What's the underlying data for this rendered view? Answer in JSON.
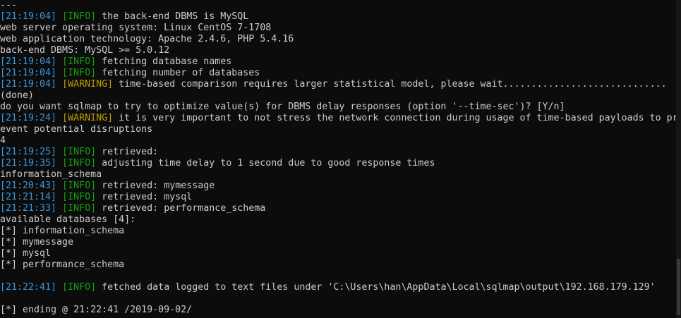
{
  "colors": {
    "background": "#0c0c0c",
    "text": "#cccccc",
    "timestamp": "#3a96dd",
    "info": "#13a10e",
    "warning": "#c19c00"
  },
  "lines": [
    [
      {
        "t": "plain",
        "v": "---"
      }
    ],
    [
      {
        "t": "time",
        "v": "[21:19:04]"
      },
      {
        "t": "plain",
        "v": " "
      },
      {
        "t": "info",
        "v": "[INFO]"
      },
      {
        "t": "plain",
        "v": " the back-end DBMS is MySQL"
      }
    ],
    [
      {
        "t": "plain",
        "v": "web server operating system: Linux CentOS 7-1708"
      }
    ],
    [
      {
        "t": "plain",
        "v": "web application technology: Apache 2.4.6, PHP 5.4.16"
      }
    ],
    [
      {
        "t": "plain",
        "v": "back-end DBMS: MySQL >= 5.0.12"
      }
    ],
    [
      {
        "t": "time",
        "v": "[21:19:04]"
      },
      {
        "t": "plain",
        "v": " "
      },
      {
        "t": "info",
        "v": "[INFO]"
      },
      {
        "t": "plain",
        "v": " fetching database names"
      }
    ],
    [
      {
        "t": "time",
        "v": "[21:19:04]"
      },
      {
        "t": "plain",
        "v": " "
      },
      {
        "t": "info",
        "v": "[INFO]"
      },
      {
        "t": "plain",
        "v": " fetching number of databases"
      }
    ],
    [
      {
        "t": "time",
        "v": "[21:19:04]"
      },
      {
        "t": "plain",
        "v": " "
      },
      {
        "t": "warn",
        "v": "[WARNING]"
      },
      {
        "t": "plain",
        "v": " time-based comparison requires larger statistical model, please wait............................."
      }
    ],
    [
      {
        "t": "plain",
        "v": "(done)"
      }
    ],
    [
      {
        "t": "plain",
        "v": "do you want sqlmap to try to optimize value(s) for DBMS delay responses (option '--time-sec')? [Y/n]"
      }
    ],
    [
      {
        "t": "time",
        "v": "[21:19:24]"
      },
      {
        "t": "plain",
        "v": " "
      },
      {
        "t": "warn",
        "v": "[WARNING]"
      },
      {
        "t": "plain",
        "v": " it is very important to not stress the network connection during usage of time-based payloads to pr"
      }
    ],
    [
      {
        "t": "plain",
        "v": "event potential disruptions"
      }
    ],
    [
      {
        "t": "plain",
        "v": "4"
      }
    ],
    [
      {
        "t": "time",
        "v": "[21:19:25]"
      },
      {
        "t": "plain",
        "v": " "
      },
      {
        "t": "info",
        "v": "[INFO]"
      },
      {
        "t": "plain",
        "v": " retrieved:"
      }
    ],
    [
      {
        "t": "time",
        "v": "[21:19:35]"
      },
      {
        "t": "plain",
        "v": " "
      },
      {
        "t": "info",
        "v": "[INFO]"
      },
      {
        "t": "plain",
        "v": " adjusting time delay to 1 second due to good response times"
      }
    ],
    [
      {
        "t": "plain",
        "v": "information_schema"
      }
    ],
    [
      {
        "t": "time",
        "v": "[21:20:43]"
      },
      {
        "t": "plain",
        "v": " "
      },
      {
        "t": "info",
        "v": "[INFO]"
      },
      {
        "t": "plain",
        "v": " retrieved: mymessage"
      }
    ],
    [
      {
        "t": "time",
        "v": "[21:21:14]"
      },
      {
        "t": "plain",
        "v": " "
      },
      {
        "t": "info",
        "v": "[INFO]"
      },
      {
        "t": "plain",
        "v": " retrieved: mysql"
      }
    ],
    [
      {
        "t": "time",
        "v": "[21:21:33]"
      },
      {
        "t": "plain",
        "v": " "
      },
      {
        "t": "info",
        "v": "[INFO]"
      },
      {
        "t": "plain",
        "v": " retrieved: performance_schema"
      }
    ],
    [
      {
        "t": "plain",
        "v": "available databases [4]:"
      }
    ],
    [
      {
        "t": "plain",
        "v": "[*] information_schema"
      }
    ],
    [
      {
        "t": "plain",
        "v": "[*] mymessage"
      }
    ],
    [
      {
        "t": "plain",
        "v": "[*] mysql"
      }
    ],
    [
      {
        "t": "plain",
        "v": "[*] performance_schema"
      }
    ],
    [
      {
        "t": "plain",
        "v": ""
      }
    ],
    [
      {
        "t": "time",
        "v": "[21:22:41]"
      },
      {
        "t": "plain",
        "v": " "
      },
      {
        "t": "info",
        "v": "[INFO]"
      },
      {
        "t": "plain",
        "v": " fetched data logged to text files under 'C:\\Users\\han\\AppData\\Local\\sqlmap\\output\\192.168.179.129'"
      }
    ],
    [
      {
        "t": "plain",
        "v": ""
      }
    ],
    [
      {
        "t": "plain",
        "v": "[*] ending @ 21:22:41 /2019-09-02/"
      }
    ]
  ]
}
